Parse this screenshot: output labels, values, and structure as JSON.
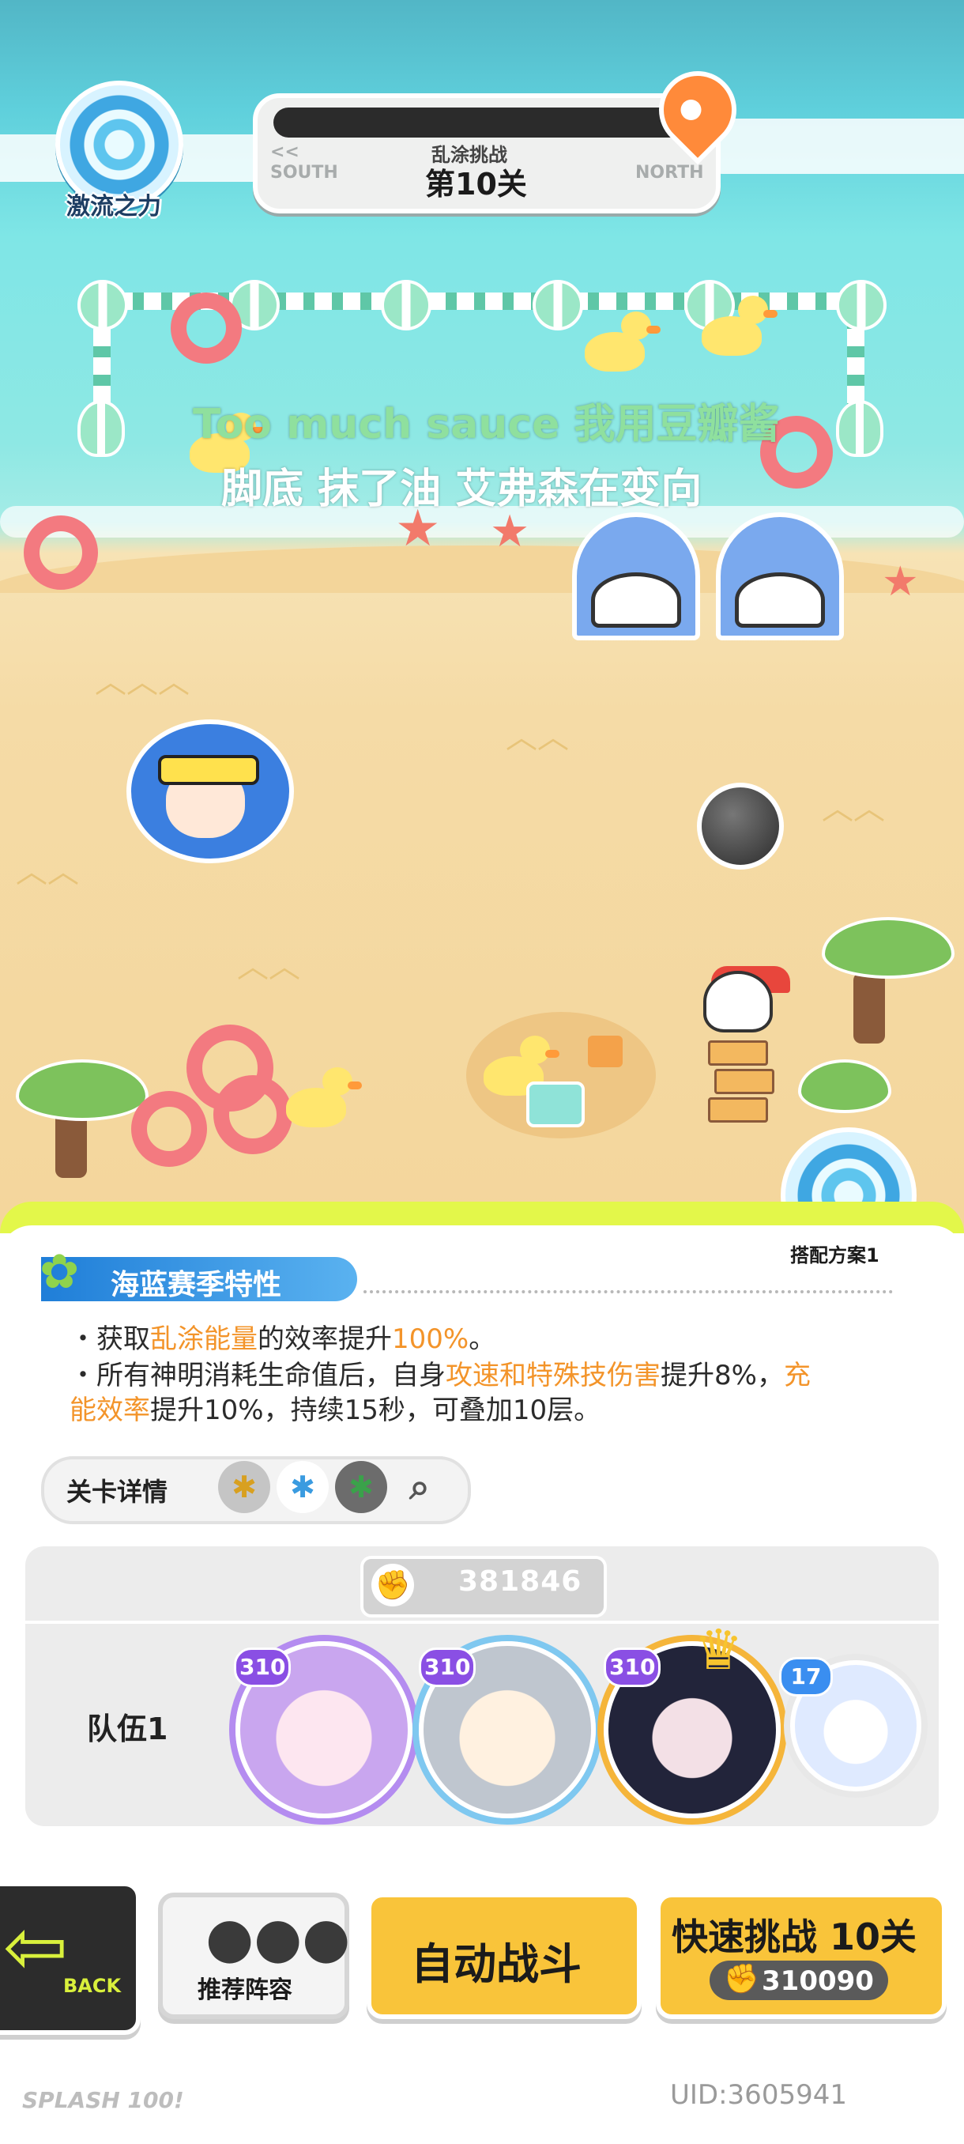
{
  "hud": {
    "top_emblem_label": "激流之力",
    "progress": {
      "left_arrow": "<<",
      "left_dir": "SOUTH",
      "right_dir": "NORTH",
      "subtitle": "乱涂挑战",
      "stage": "第10关"
    },
    "swap_label": "搭配方案1"
  },
  "lyrics": {
    "line1": "Too much sauce 我用豆瓣酱",
    "line2": "脚底 抹了油 艾弗森在变向"
  },
  "trait": {
    "title": "海蓝赛季特性",
    "l1_a": "・获取",
    "l1_b": "乱涂能量",
    "l1_c": "的效率提升",
    "l1_d": "100%",
    "l1_e": "。",
    "l2_a": "・所有神明消耗生命值后，自身",
    "l2_b": "攻速和特殊技伤害",
    "l2_c": "提升8%，",
    "l2_d": "充",
    "l3_a": "能效率",
    "l3_b": "提升10%，持续15秒，可叠加10层。"
  },
  "details": {
    "label": "关卡详情",
    "elements": [
      {
        "icon": "yellow-splat-icon",
        "glyph": "✱",
        "color": "#d8a020"
      },
      {
        "icon": "blue-splat-icon",
        "glyph": "✱",
        "color": "#3a9be0"
      },
      {
        "icon": "green-splat-icon",
        "glyph": "✱",
        "color": "#3aa24a"
      }
    ]
  },
  "team": {
    "power": "381846",
    "label": "队伍1",
    "members": [
      {
        "level": "310",
        "ring": "#b48cf0"
      },
      {
        "level": "310",
        "ring": "#7fc8f0"
      },
      {
        "level": "310",
        "ring": "#f5b53a"
      },
      {
        "level": "17",
        "ring": "#e8e8e8"
      }
    ]
  },
  "buttons": {
    "back": "BACK",
    "recommend": "推荐阵容",
    "auto": "自动战斗",
    "quick": "快速挑战 10关",
    "quick_power": "310090"
  },
  "footer": {
    "brand": "SPLASH 100!",
    "uid": "UID:3605941"
  },
  "colors": {
    "accent_yellow": "#f9c43a",
    "trait_blue": "#1f7ed8",
    "highlight_orange": "#f3942a",
    "slime_green": "#e3f74a"
  }
}
